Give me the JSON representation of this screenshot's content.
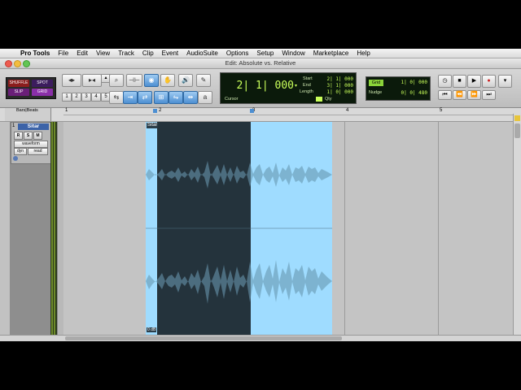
{
  "menubar": {
    "app": "Pro Tools",
    "items": [
      "File",
      "Edit",
      "View",
      "Track",
      "Clip",
      "Event",
      "AudioSuite",
      "Options",
      "Setup",
      "Window",
      "Marketplace",
      "Help"
    ]
  },
  "window": {
    "title": "Edit: Absolute vs. Relative"
  },
  "toolbar": {
    "modes": [
      "SHUFFLE",
      "SPOT",
      "SLIP",
      "GRID"
    ],
    "zoom_presets": [
      "1",
      "2",
      "3",
      "4",
      "5"
    ],
    "counter": {
      "main": "2| 1| 000",
      "start_label": "Start",
      "start_value": "2| 1| 000",
      "end_label": "End",
      "end_value": "3| 1| 000",
      "length_label": "Length",
      "length_value": "1| 0| 000",
      "cursor_label": "Cursor",
      "quantize_label": "Qty"
    },
    "grid": {
      "label": "Grid",
      "value": "1| 0| 000",
      "nudge_label": "Nudge",
      "nudge_value": "0| 0| 480"
    }
  },
  "ruler": {
    "header": "Bars|Beats",
    "marks": [
      "1",
      "2",
      "3",
      "4",
      "5"
    ]
  },
  "track": {
    "number": "1",
    "name": "Sitar",
    "buttons": [
      "R",
      "S",
      "M"
    ],
    "view": "waveform",
    "dyn": "dyn",
    "automation": "read"
  },
  "clip": {
    "name": "Sitar",
    "gain": "0 dB"
  }
}
